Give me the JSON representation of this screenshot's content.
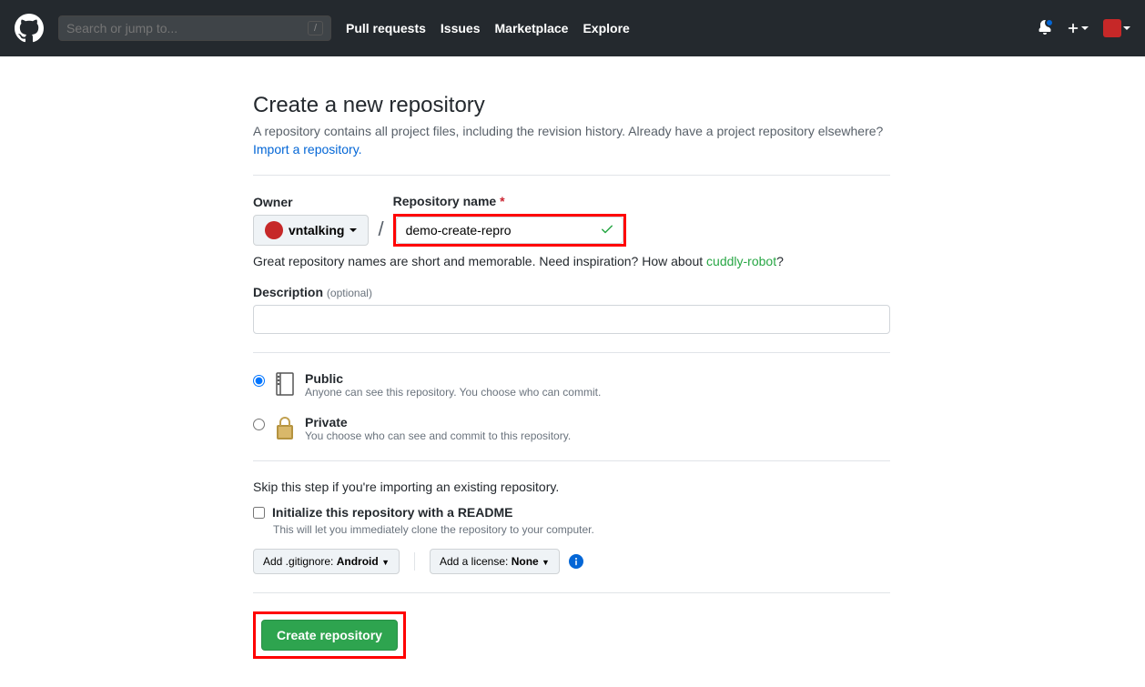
{
  "header": {
    "search_placeholder": "Search or jump to...",
    "nav": {
      "pulls": "Pull requests",
      "issues": "Issues",
      "marketplace": "Marketplace",
      "explore": "Explore"
    }
  },
  "page": {
    "title": "Create a new repository",
    "subhead": "A repository contains all project files, including the revision history. Already have a project repository elsewhere?",
    "import_link": "Import a repository."
  },
  "form": {
    "owner_label": "Owner",
    "owner_value": "vntalking",
    "repo_label": "Repository name",
    "repo_value": "demo-create-repro",
    "hint_pre": "Great repository names are short and memorable. Need inspiration? How about ",
    "hint_suggestion": "cuddly-robot",
    "hint_post": "?",
    "desc_label": "Description",
    "desc_optional": "(optional)",
    "visibility": {
      "public": {
        "title": "Public",
        "sub": "Anyone can see this repository. You choose who can commit."
      },
      "private": {
        "title": "Private",
        "sub": "You choose who can see and commit to this repository."
      }
    },
    "skip_text": "Skip this step if you're importing an existing repository.",
    "readme": {
      "title": "Initialize this repository with a README",
      "sub": "This will let you immediately clone the repository to your computer."
    },
    "gitignore": {
      "pre": "Add .gitignore: ",
      "value": "Android"
    },
    "license": {
      "pre": "Add a license: ",
      "value": "None"
    },
    "submit": "Create repository"
  }
}
